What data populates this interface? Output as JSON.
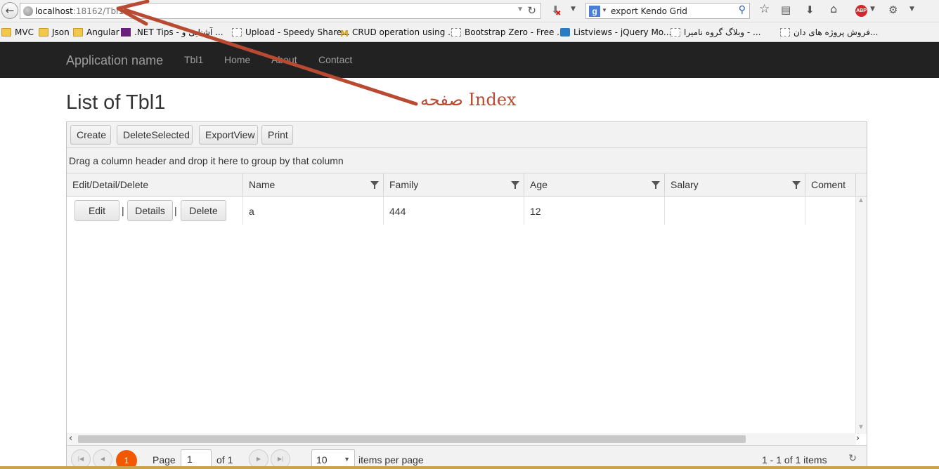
{
  "browser": {
    "url_host": "localhost",
    "url_rest": ":18162/Tbl1",
    "search_text": "export Kendo Grid",
    "bookmarks": [
      {
        "label": "MVC",
        "icon": "folder"
      },
      {
        "label": "Json",
        "icon": "folder"
      },
      {
        "label": "Angular",
        "icon": "folder"
      },
      {
        "label": ".NET Tips - آشنایی و ...",
        "icon": "visual-studio"
      },
      {
        "label": "Upload - Speedy Share...",
        "icon": "page"
      },
      {
        "label": "CRUD operation using ...",
        "icon": "mcdonalds"
      },
      {
        "label": "Bootstrap Zero - Free ...",
        "icon": "page"
      },
      {
        "label": "Listviews - jQuery Mo...",
        "icon": "jquery"
      },
      {
        "label": "وبلاگ گروه نامیرا - ...",
        "icon": "page"
      },
      {
        "label": "فروش پروژه های دان...",
        "icon": "page"
      }
    ]
  },
  "navbar": {
    "brand": "Application name",
    "links": [
      "Tbl1",
      "Home",
      "About",
      "Contact"
    ]
  },
  "page": {
    "title": "List of Tbl1",
    "annotation": "صفحه Index",
    "annotation_color": "#b84a32"
  },
  "grid": {
    "toolbar": [
      "Create",
      "DeleteSelected",
      "ExportView",
      "Print"
    ],
    "group_hint": "Drag a column header and drop it here to group by that column",
    "columns": [
      "Edit/Detail/Delete",
      "Name",
      "Family",
      "Age",
      "Salary",
      "Coment"
    ],
    "rows": [
      {
        "actions": [
          "Edit",
          "Details",
          "Delete"
        ],
        "name": "a",
        "family": "444",
        "age": "12",
        "salary": "",
        "coment": ""
      }
    ],
    "pager": {
      "current_page": "1",
      "page_label": "Page",
      "page_input": "1",
      "of_label": "of 1",
      "page_size": "10",
      "items_per_page_label": "items per page",
      "summary": "1 - 1 of 1 items"
    }
  }
}
